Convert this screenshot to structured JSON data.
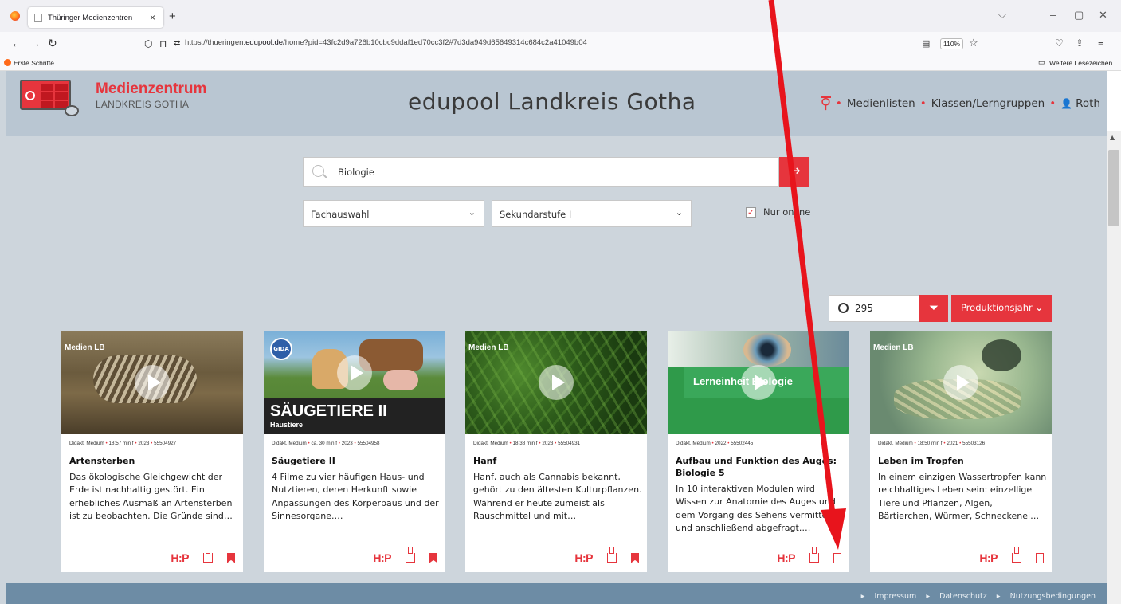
{
  "browser": {
    "tab_title": "Thüringer Medienzentren",
    "url_prefix": "https://thueringen.",
    "url_domain": "edupool.de",
    "url_rest": "/home?pid=43fc2d9a726b10cbc9ddaf1ed70cc3f2#7d3da949d65649314c684c2a41049b04",
    "zoom": "110%",
    "bookmark_first": "Erste Schritte",
    "bookmark_other": "Weitere Lesezeichen"
  },
  "header": {
    "logo_title": "Medienzentrum",
    "logo_sub": "LANDKREIS GOTHA",
    "site_title": "edupool Landkreis Gotha",
    "nav": [
      "Medienlisten",
      "Klassen/Lerngruppen",
      "Roth"
    ]
  },
  "search": {
    "value": "Biologie",
    "subject": "Fachauswahl",
    "level": "Sekundarstufe I",
    "online_label": "Nur online",
    "online_checked": true
  },
  "results": {
    "count": "295",
    "sort_label": "Produktionsjahr"
  },
  "cards": [
    {
      "type": "Didakt. Medium",
      "meta": [
        "18:57 min f",
        "2023",
        "55504927"
      ],
      "title": "Artensterben",
      "desc": "Das ökologische Gleichgewicht der Erde ist nachhaltig gestört. Ein erhebliches Ausmaß an Artensterben ist zu beobachten. Die Gründe sind…",
      "bookmarked": true
    },
    {
      "type": "Didakt. Medium",
      "meta": [
        "ca. 30 min f",
        "2023",
        "55504958"
      ],
      "title": "Säugetiere II",
      "desc": "4 Filme zu vier häufigen Haus- und Nutztieren, deren Herkunft sowie Anpassungen des Körperbaus und der Sinnesorgane.…",
      "thumb_title": "SÄUGETIERE II",
      "thumb_sub": "Haustiere",
      "bookmarked": true
    },
    {
      "type": "Didakt. Medium",
      "meta": [
        "18:38 min f",
        "2023",
        "55504931"
      ],
      "title": "Hanf",
      "desc": "Hanf, auch als Cannabis bekannt, gehört zu den ältesten Kulturpflanzen. Während er heute zumeist als Rauschmittel und mit…",
      "bookmarked": true
    },
    {
      "type": "Didakt. Medium",
      "meta": [
        "2022",
        "55502445"
      ],
      "title": "Aufbau und Funktion des Auges: Biologie 5",
      "desc": "In 10 interaktiven Modulen wird Wissen zur Anatomie des Auges und dem Vorgang des Sehens vermittelt und anschließend abgefragt.…",
      "thumb_title": "Lerneinheit Biologie",
      "bookmarked": false
    },
    {
      "type": "Didakt. Medium",
      "meta": [
        "18:50 min f",
        "2021",
        "55503126"
      ],
      "title": "Leben im Tropfen",
      "desc": "In einem einzigen Wassertropfen kann reichhaltiges Leben sein: einzellige Tiere und Pflanzen, Algen, Bärtierchen, Würmer, Schneckenei…",
      "bookmarked": false
    }
  ],
  "footer": [
    "Impressum",
    "Datenschutz",
    "Nutzungsbedingungen"
  ],
  "colors": {
    "accent": "#e6353d",
    "header_bg": "#b9c6d2",
    "page_bg": "#cdd5dc",
    "footer_bg": "#6d8ca5"
  }
}
